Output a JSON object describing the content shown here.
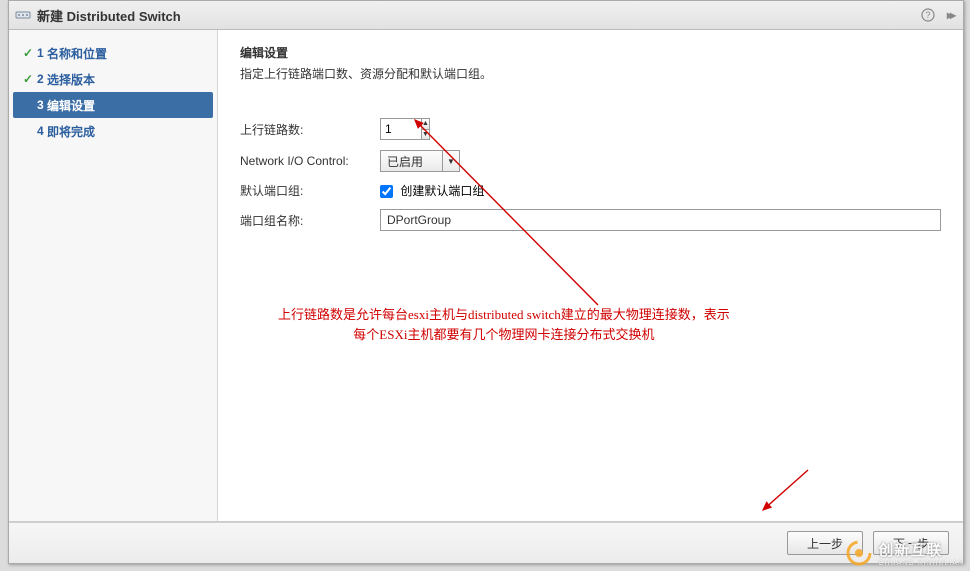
{
  "title": "新建 Distributed Switch",
  "steps": [
    {
      "num": "1",
      "label": "名称和位置",
      "state": "done"
    },
    {
      "num": "2",
      "label": "选择版本",
      "state": "done"
    },
    {
      "num": "3",
      "label": "编辑设置",
      "state": "active"
    },
    {
      "num": "4",
      "label": "即将完成",
      "state": "pending"
    }
  ],
  "section": {
    "title": "编辑设置",
    "desc": "指定上行链路端口数、资源分配和默认端口组。"
  },
  "form": {
    "uplinks_label": "上行链路数:",
    "uplinks_value": "1",
    "nioc_label": "Network I/O Control:",
    "nioc_value": "已启用",
    "default_pg_label": "默认端口组:",
    "default_pg_checkbox_label": "创建默认端口组",
    "default_pg_checked": true,
    "pg_name_label": "端口组名称:",
    "pg_name_value": "DPortGroup"
  },
  "footer": {
    "back": "上一步",
    "next": "下一步"
  },
  "annotation": {
    "line1": "上行链路数是允许每台esxi主机与distributed  switch建立的最大物理连接数，表示",
    "line2": "每个ESXi主机都要有几个物理网卡连接分布式交换机"
  },
  "watermark": {
    "main": "创新互联",
    "sub": "CHUANG XINHULIAN"
  }
}
